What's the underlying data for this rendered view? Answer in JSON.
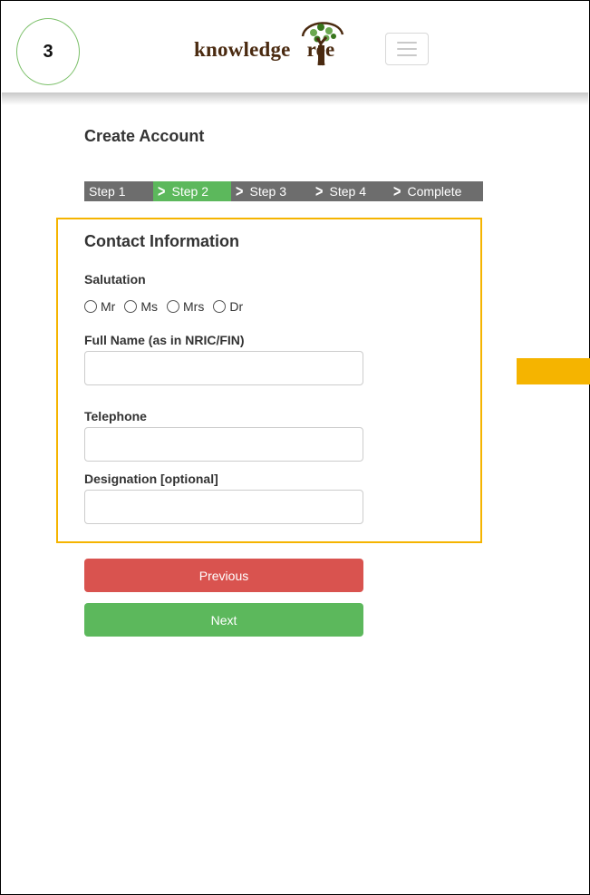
{
  "annotation": {
    "step_number": "3"
  },
  "header": {
    "logo_text_left": "knowledge",
    "logo_text_right": "ree",
    "menu_icon": "hamburger-icon"
  },
  "page": {
    "title": "Create Account"
  },
  "stepper": {
    "steps": [
      "Step 1",
      "Step 2",
      "Step 3",
      "Step 4",
      "Complete"
    ],
    "active_index": 1,
    "active_color": "#5cb85c",
    "inactive_color": "#6d6d6d"
  },
  "form": {
    "section_title": "Contact Information",
    "salutation_label": "Salutation",
    "salutations": [
      "Mr",
      "Ms",
      "Mrs",
      "Dr"
    ],
    "full_name_label": "Full Name (as in NRIC/FIN)",
    "full_name_value": "",
    "telephone_label": "Telephone",
    "telephone_value": "",
    "designation_label": "Designation [optional]",
    "designation_value": ""
  },
  "buttons": {
    "previous": "Previous",
    "next": "Next"
  },
  "colors": {
    "highlight": "#f5b400",
    "previous": "#d9534f",
    "next": "#5cb85c"
  }
}
